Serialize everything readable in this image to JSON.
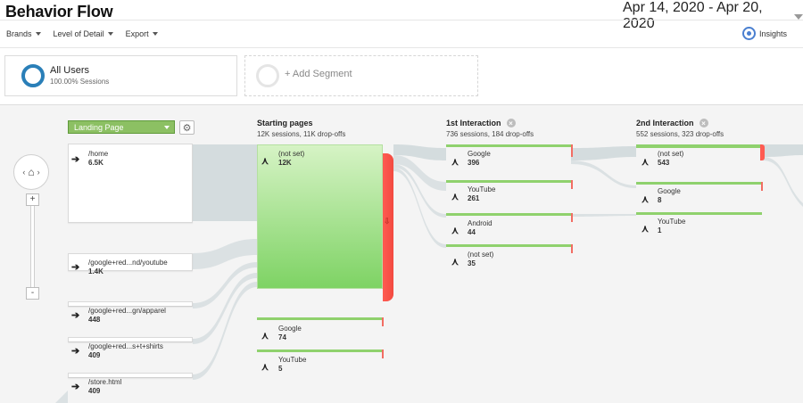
{
  "header": {
    "title": "Behavior Flow",
    "date_range": "Apr 14, 2020 - Apr 20, 2020"
  },
  "toolbar": {
    "brands": "Brands",
    "level_of_detail": "Level of Detail",
    "export": "Export",
    "insights": "Insights"
  },
  "segments": {
    "all_users": {
      "name": "All Users",
      "sub": "100.00% Sessions"
    },
    "add_segment": "+ Add Segment"
  },
  "controls": {
    "dimension_select": "Landing Page",
    "settings_icon": "gear-icon",
    "zoom_in": "+",
    "zoom_out": "-",
    "nav_left": "‹",
    "nav_right": "›"
  },
  "columns": [
    {
      "title": "Starting pages",
      "sub": "12K sessions, 11K drop-offs"
    },
    {
      "title": "1st Interaction",
      "sub": "736 sessions, 184 drop-offs"
    },
    {
      "title": "2nd Interaction",
      "sub": "552 sessions, 323 drop-offs"
    }
  ],
  "landing_pages": [
    {
      "name": "/home",
      "value": "6.5K"
    },
    {
      "name": "/google+red...nd/youtube",
      "value": "1.4K"
    },
    {
      "name": "/google+red...gn/apparel",
      "value": "448"
    },
    {
      "name": "/google+red...s+t+shirts",
      "value": "409"
    },
    {
      "name": "/store.html",
      "value": "409"
    }
  ],
  "starting_pages": [
    {
      "name": "(not set)",
      "value": "12K"
    },
    {
      "name": "Google",
      "value": "74"
    },
    {
      "name": "YouTube",
      "value": "5"
    }
  ],
  "first_interaction": [
    {
      "name": "Google",
      "value": "396"
    },
    {
      "name": "YouTube",
      "value": "261"
    },
    {
      "name": "Android",
      "value": "44"
    },
    {
      "name": "(not set)",
      "value": "35"
    }
  ],
  "second_interaction": [
    {
      "name": "(not set)",
      "value": "543"
    },
    {
      "name": "Google",
      "value": "8"
    },
    {
      "name": "YouTube",
      "value": "1"
    }
  ],
  "colors": {
    "accent_green": "#8cc063",
    "drop_off_red": "#ff5b52",
    "segment_blue": "#2a7fb8",
    "flow_gray": "#d4dcde"
  }
}
